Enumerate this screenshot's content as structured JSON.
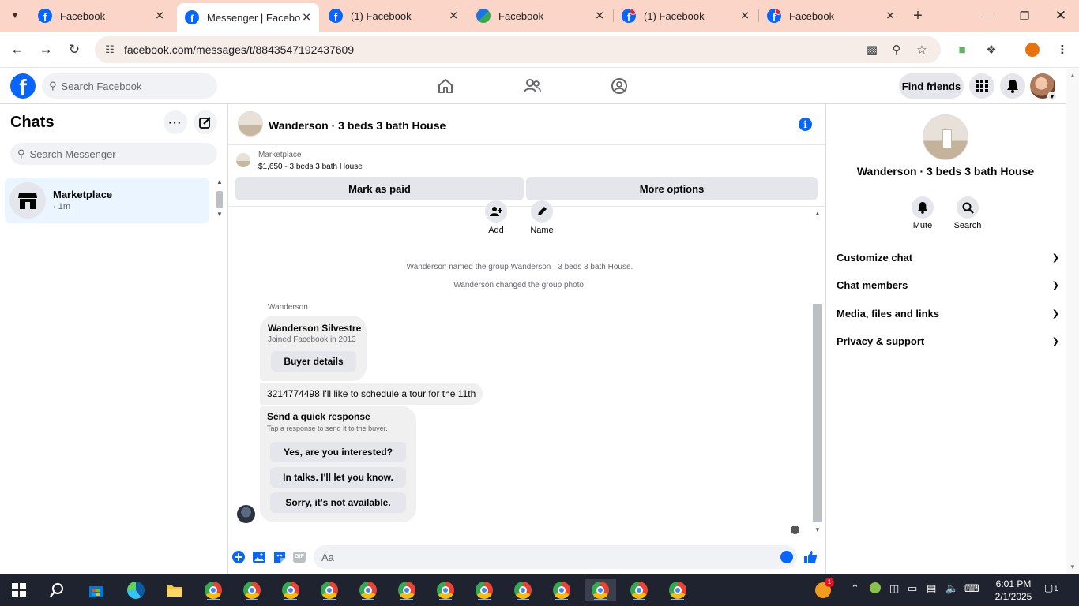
{
  "browser": {
    "tabs": [
      {
        "title": "Facebook",
        "favicon": "facebook-icon",
        "active": false
      },
      {
        "title": "Messenger | Facebook",
        "favicon": "facebook-icon",
        "active": true
      },
      {
        "title": "(1) Facebook",
        "favicon": "facebook-icon",
        "active": false
      },
      {
        "title": "Facebook",
        "favicon": "globe-icon",
        "active": false
      },
      {
        "title": "(1) Facebook",
        "favicon": "facebook-notification-icon",
        "active": false
      },
      {
        "title": "Facebook",
        "favicon": "facebook-notification-icon",
        "active": false
      }
    ],
    "url": "facebook.com/messages/t/8843547192437609",
    "accent": "#fbd5c7"
  },
  "facebook": {
    "logo_letter": "f",
    "search_placeholder": "Search Facebook",
    "find_friends": "Find friends",
    "brand_color": "#0866ff"
  },
  "chats": {
    "title": "Chats",
    "search_placeholder": "Search Messenger",
    "items": [
      {
        "name": "Marketplace",
        "time": "· 1m"
      }
    ]
  },
  "conversation": {
    "title": "Wanderson · 3 beds 3 bath House",
    "marketplace_label": "Marketplace",
    "listing": "$1,650 - 3 beds 3 bath House",
    "mark_paid": "Mark as paid",
    "more_options": "More options",
    "actions": [
      {
        "label": "Add",
        "icon": "add-person-icon"
      },
      {
        "label": "Name",
        "icon": "pencil-icon"
      }
    ],
    "system_messages": [
      "Wanderson named the group Wanderson · 3 beds 3 bath House.",
      "Wanderson changed the group photo."
    ],
    "sender": "Wanderson",
    "profile_card": {
      "name": "Wanderson Silvestre",
      "joined": "Joined Facebook in 2013",
      "button": "Buyer details"
    },
    "message": "3214774498 I'll like to schedule a tour for the 11th",
    "quick_response": {
      "title": "Send a quick response",
      "subtitle": "Tap a response to send it to the buyer.",
      "options": [
        "Yes, are you interested?",
        "In talks. I'll let you know.",
        "Sorry, it's not available."
      ]
    },
    "composer_placeholder": "Aa"
  },
  "details": {
    "title": "Wanderson · 3 beds 3 bath House",
    "buttons": [
      {
        "label": "Mute",
        "icon": "bell-icon"
      },
      {
        "label": "Search",
        "icon": "search-icon"
      }
    ],
    "sections": [
      "Customize chat",
      "Chat members",
      "Media, files and links",
      "Privacy & support"
    ]
  },
  "taskbar": {
    "time": "6:01 PM",
    "date": "2/1/2025",
    "notification_count": "1",
    "weather_badge": "1"
  }
}
